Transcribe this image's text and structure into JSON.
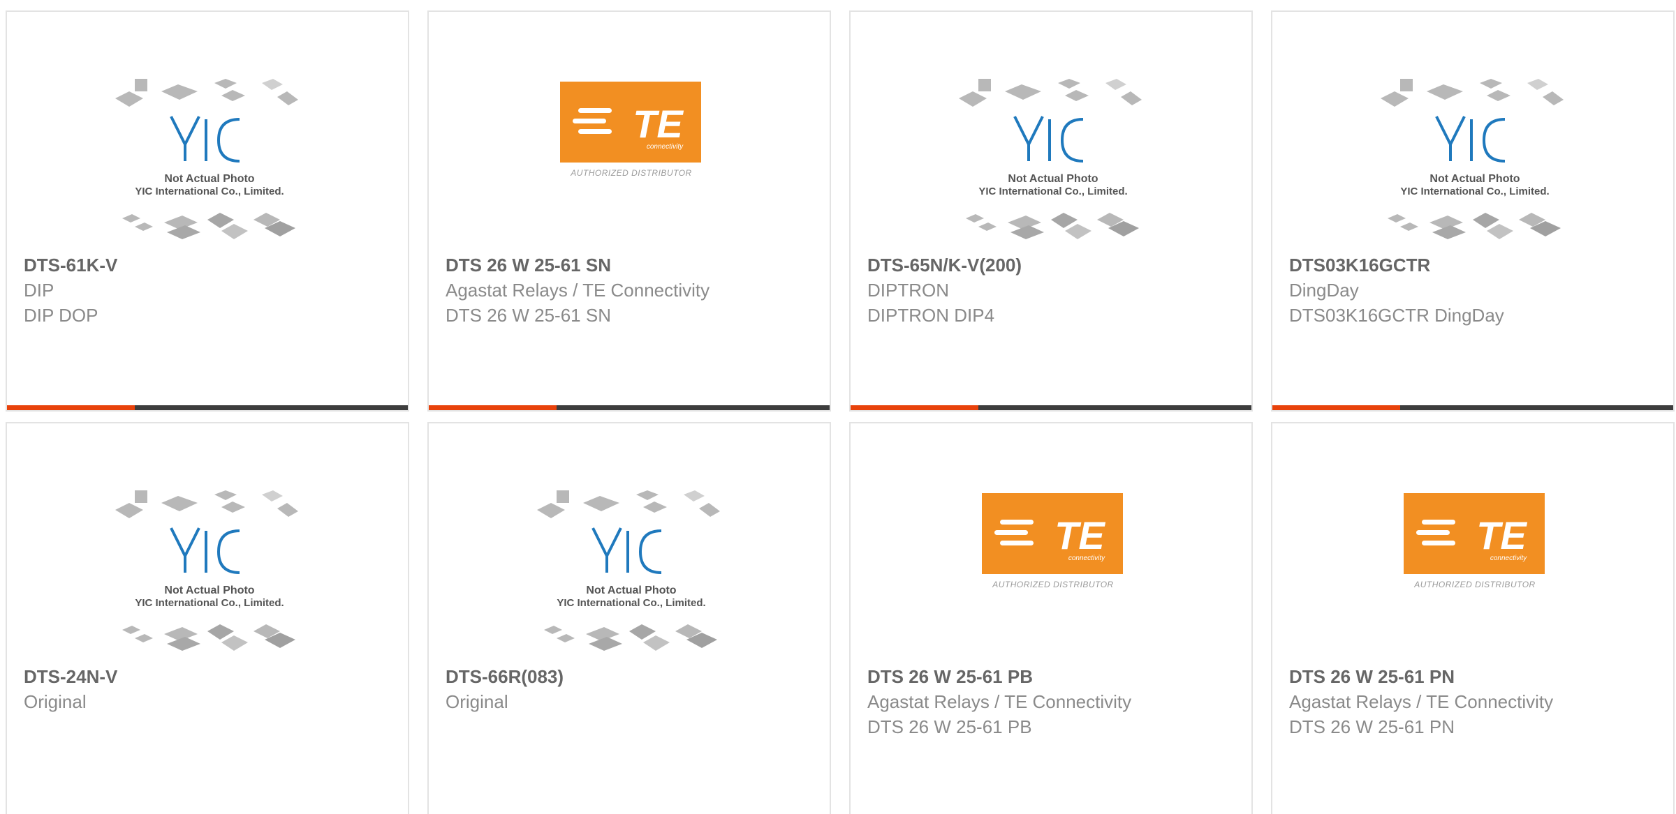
{
  "colors": {
    "accent": "#e8420b",
    "bar": "#3d3d3d",
    "te_orange": "#f28f22",
    "yic_blue": "#1f79bd",
    "title_text": "#666666",
    "body_text": "#8a8a8a"
  },
  "placeholder_image": {
    "icon": "yic-placeholder-image",
    "line1": "Not Actual Photo",
    "line2": "YIC International Co., Limited."
  },
  "te_logo": {
    "icon": "te-connectivity-logo",
    "brand": "TE",
    "sub": "connectivity",
    "caption": "AUTHORIZED DISTRIBUTOR"
  },
  "products": [
    {
      "image": "yic",
      "title": "DTS-61K-V",
      "lines": [
        "DIP",
        "DIP DOP"
      ]
    },
    {
      "image": "te",
      "title": "DTS 26 W 25-61 SN",
      "lines": [
        "Agastat Relays / TE Connectivity",
        "DTS 26 W 25-61 SN"
      ]
    },
    {
      "image": "yic",
      "title": "DTS-65N/K-V(200)",
      "lines": [
        "DIPTRON",
        "DIPTRON DIP4"
      ]
    },
    {
      "image": "yic",
      "title": "DTS03K16GCTR",
      "lines": [
        "DingDay",
        "DTS03K16GCTR DingDay"
      ]
    },
    {
      "image": "yic",
      "title": "DTS-24N-V",
      "lines": [
        "Original"
      ]
    },
    {
      "image": "yic",
      "title": "DTS-66R(083)",
      "lines": [
        "Original"
      ]
    },
    {
      "image": "te",
      "title": "DTS 26 W 25-61 PB",
      "lines": [
        "Agastat Relays / TE Connectivity",
        "DTS 26 W 25-61 PB"
      ]
    },
    {
      "image": "te",
      "title": "DTS 26 W 25-61 PN",
      "lines": [
        "Agastat Relays / TE Connectivity",
        "DTS 26 W 25-61 PN"
      ]
    }
  ]
}
